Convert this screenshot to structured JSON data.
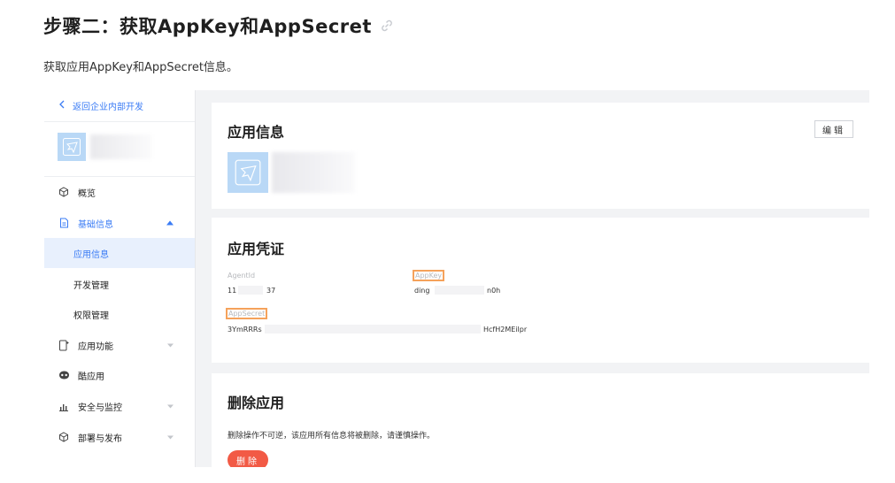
{
  "doc": {
    "title": "步骤二：获取AppKey和AppSecret",
    "description": "获取应用AppKey和AppSecret信息。"
  },
  "sidebar": {
    "back_label": "返回企业内部开发",
    "items": [
      {
        "label": "概览",
        "icon": "cube-icon"
      },
      {
        "label": "基础信息",
        "icon": "document-icon",
        "expanded": true
      },
      {
        "label": "应用信息",
        "selected": true
      },
      {
        "label": "开发管理"
      },
      {
        "label": "权限管理"
      },
      {
        "label": "应用功能",
        "icon": "phone-plus-icon"
      },
      {
        "label": "酷应用",
        "icon": "cool-app-icon"
      },
      {
        "label": "安全与监控",
        "icon": "bar-chart-icon"
      },
      {
        "label": "部署与发布",
        "icon": "cube-icon"
      }
    ]
  },
  "app_info": {
    "title": "应用信息",
    "edit_label": "编辑"
  },
  "credentials": {
    "title": "应用凭证",
    "agentid_label": "AgentId",
    "agentid_prefix": "11",
    "agentid_suffix": "37",
    "appkey_label": "AppKey",
    "appkey_prefix": "ding",
    "appkey_suffix": "n0h",
    "appsecret_label": "AppSecret",
    "appsecret_prefix": "3YmRRRs",
    "appsecret_suffix": "HcfH2MEilpr"
  },
  "delete_app": {
    "title": "删除应用",
    "warning": "删除操作不可逆，该应用所有信息将被删除，请谨慎操作。",
    "button_label": "删除"
  },
  "colors": {
    "accent": "#3b7cf5",
    "highlight_box": "#f5a25b",
    "delete": "#f25a45",
    "app_tile": "#b9d8f6"
  }
}
